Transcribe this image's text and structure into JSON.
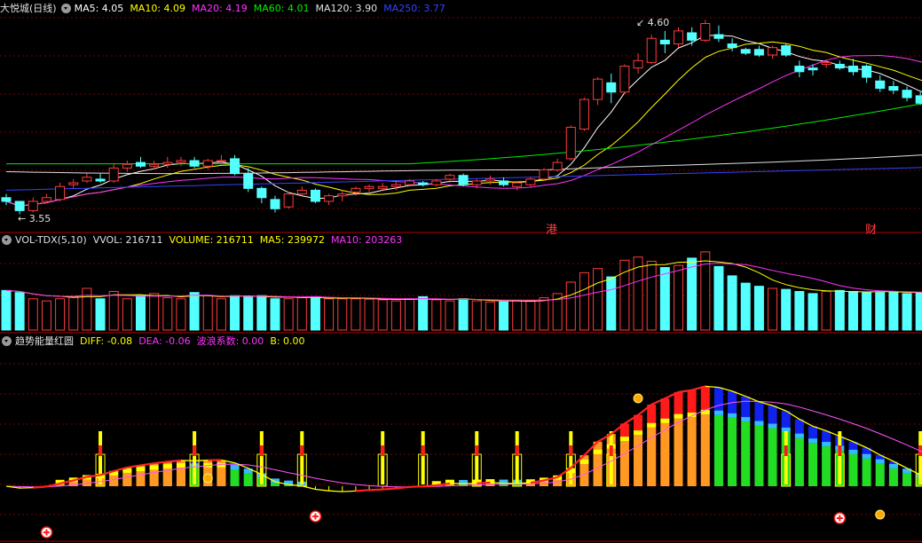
{
  "colors": {
    "up": "#ff3c3c",
    "down": "#54ffff",
    "ma5": "#ffffff",
    "ma10": "#ffff00",
    "ma20": "#ff33ff",
    "ma60": "#00ee00",
    "ma120": "#e0e0e0",
    "ma250": "#3344ff",
    "grid": "#7a0000",
    "separator": "#8c0000",
    "diff": "#ff2222",
    "dea": "#ff55ff",
    "yellow": "#ffff00",
    "orange": "#ff9922",
    "green": "#22dd22",
    "red": "#ff1a1a",
    "blue": "#1122ee",
    "cyan": "#33bbff"
  },
  "price_panel": {
    "title": "大悦城(日线)",
    "ma_labels": [
      {
        "text": "MA5: 4.05",
        "color": "#ffffff"
      },
      {
        "text": "MA10: 4.09",
        "color": "#ffff00"
      },
      {
        "text": "MA20: 4.19",
        "color": "#ff33ff"
      },
      {
        "text": "MA60: 4.01",
        "color": "#00ee00"
      },
      {
        "text": "MA120: 3.90",
        "color": "#e0e0e0"
      },
      {
        "text": "MA250: 3.77",
        "color": "#3344ff"
      }
    ],
    "high_label": "4.60",
    "low_label": "3.55",
    "event_marks": [
      "港",
      "财"
    ]
  },
  "volume_panel": {
    "labels": [
      {
        "text": "VOL-TDX(5,10)",
        "color": "#e0e0e0"
      },
      {
        "text": "VVOL: 216711",
        "color": "#e0e0e0"
      },
      {
        "text": "VOLUME: 216711",
        "color": "#ffff00"
      },
      {
        "text": "MA5: 239972",
        "color": "#ffff00"
      },
      {
        "text": "MA10: 203263",
        "color": "#ff33ff"
      }
    ]
  },
  "indicator_panel": {
    "labels": [
      {
        "text": "趋势能量红圆",
        "color": "#e0e0e0"
      },
      {
        "text": "DIFF: -0.08",
        "color": "#ffff00"
      },
      {
        "text": "DEA: -0.06",
        "color": "#ff33ff"
      },
      {
        "text": "波浪系数: 0.00",
        "color": "#ff33ff"
      },
      {
        "text": "B: 0.00",
        "color": "#ffff00"
      }
    ]
  },
  "chart_data": {
    "type": "candlestick",
    "candles": [
      [
        3.64,
        3.66,
        3.6,
        3.62
      ],
      [
        3.62,
        3.62,
        3.55,
        3.57
      ],
      [
        3.57,
        3.64,
        3.56,
        3.62
      ],
      [
        3.62,
        3.66,
        3.61,
        3.64
      ],
      [
        3.63,
        3.72,
        3.62,
        3.7
      ],
      [
        3.71,
        3.74,
        3.69,
        3.72
      ],
      [
        3.73,
        3.77,
        3.72,
        3.75
      ],
      [
        3.74,
        3.77,
        3.72,
        3.73
      ],
      [
        3.73,
        3.82,
        3.72,
        3.8
      ],
      [
        3.8,
        3.84,
        3.78,
        3.82
      ],
      [
        3.83,
        3.86,
        3.8,
        3.81
      ],
      [
        3.81,
        3.84,
        3.79,
        3.82
      ],
      [
        3.82,
        3.86,
        3.8,
        3.83
      ],
      [
        3.83,
        3.86,
        3.81,
        3.84
      ],
      [
        3.84,
        3.86,
        3.8,
        3.81
      ],
      [
        3.81,
        3.85,
        3.79,
        3.84
      ],
      [
        3.84,
        3.87,
        3.82,
        3.84
      ],
      [
        3.85,
        3.87,
        3.76,
        3.77
      ],
      [
        3.77,
        3.8,
        3.67,
        3.69
      ],
      [
        3.69,
        3.7,
        3.61,
        3.64
      ],
      [
        3.63,
        3.65,
        3.56,
        3.58
      ],
      [
        3.59,
        3.67,
        3.58,
        3.66
      ],
      [
        3.66,
        3.7,
        3.65,
        3.68
      ],
      [
        3.68,
        3.69,
        3.61,
        3.62
      ],
      [
        3.62,
        3.66,
        3.6,
        3.65
      ],
      [
        3.65,
        3.68,
        3.62,
        3.66
      ],
      [
        3.67,
        3.7,
        3.65,
        3.69
      ],
      [
        3.69,
        3.71,
        3.67,
        3.7
      ],
      [
        3.69,
        3.72,
        3.68,
        3.7
      ],
      [
        3.7,
        3.73,
        3.68,
        3.71
      ],
      [
        3.71,
        3.74,
        3.7,
        3.73
      ],
      [
        3.72,
        3.73,
        3.7,
        3.71
      ],
      [
        3.71,
        3.74,
        3.7,
        3.73
      ],
      [
        3.74,
        3.77,
        3.72,
        3.76
      ],
      [
        3.76,
        3.77,
        3.7,
        3.71
      ],
      [
        3.71,
        3.74,
        3.69,
        3.73
      ],
      [
        3.73,
        3.76,
        3.71,
        3.74
      ],
      [
        3.73,
        3.75,
        3.7,
        3.71
      ],
      [
        3.7,
        3.73,
        3.68,
        3.72
      ],
      [
        3.71,
        3.75,
        3.7,
        3.74
      ],
      [
        3.74,
        3.8,
        3.73,
        3.79
      ],
      [
        3.79,
        3.85,
        3.78,
        3.83
      ],
      [
        3.85,
        4.03,
        3.84,
        4.02
      ],
      [
        4.01,
        4.18,
        4.0,
        4.17
      ],
      [
        4.17,
        4.29,
        4.14,
        4.28
      ],
      [
        4.26,
        4.31,
        4.15,
        4.21
      ],
      [
        4.21,
        4.36,
        4.2,
        4.35
      ],
      [
        4.34,
        4.42,
        4.31,
        4.38
      ],
      [
        4.37,
        4.52,
        4.36,
        4.5
      ],
      [
        4.49,
        4.54,
        4.42,
        4.47
      ],
      [
        4.47,
        4.56,
        4.45,
        4.54
      ],
      [
        4.53,
        4.56,
        4.46,
        4.49
      ],
      [
        4.49,
        4.6,
        4.48,
        4.58
      ],
      [
        4.52,
        4.57,
        4.48,
        4.5
      ],
      [
        4.47,
        4.5,
        4.43,
        4.45
      ],
      [
        4.44,
        4.45,
        4.41,
        4.42
      ],
      [
        4.44,
        4.46,
        4.4,
        4.41
      ],
      [
        4.41,
        4.46,
        4.39,
        4.45
      ],
      [
        4.46,
        4.47,
        4.4,
        4.41
      ],
      [
        4.35,
        4.38,
        4.29,
        4.32
      ],
      [
        4.34,
        4.36,
        4.3,
        4.33
      ],
      [
        4.36,
        4.38,
        4.34,
        4.37
      ],
      [
        4.36,
        4.38,
        4.33,
        4.34
      ],
      [
        4.35,
        4.39,
        4.3,
        4.32
      ],
      [
        4.35,
        4.36,
        4.26,
        4.29
      ],
      [
        4.27,
        4.3,
        4.21,
        4.23
      ],
      [
        4.24,
        4.27,
        4.2,
        4.22
      ],
      [
        4.22,
        4.24,
        4.16,
        4.18
      ],
      [
        4.19,
        4.21,
        4.14,
        4.15
      ],
      [
        4.16,
        4.22,
        4.15,
        4.2
      ],
      [
        4.25,
        4.42,
        4.24,
        4.41
      ],
      [
        4.35,
        4.38,
        4.3,
        4.32
      ],
      [
        4.32,
        4.36,
        4.3,
        4.35
      ],
      [
        4.33,
        4.34,
        4.22,
        4.25
      ],
      [
        4.27,
        4.3,
        4.07,
        4.08
      ],
      [
        4.05,
        4.1,
        4.04,
        4.09
      ],
      [
        4.12,
        4.14,
        4.09,
        4.11
      ]
    ],
    "volume": [
      190,
      180,
      150,
      140,
      150,
      160,
      200,
      150,
      185,
      150,
      165,
      175,
      155,
      150,
      180,
      165,
      150,
      165,
      160,
      165,
      150,
      150,
      155,
      160,
      150,
      150,
      150,
      148,
      145,
      140,
      150,
      160,
      145,
      140,
      150,
      140,
      135,
      135,
      140,
      140,
      155,
      175,
      230,
      275,
      295,
      255,
      335,
      350,
      330,
      300,
      310,
      345,
      375,
      305,
      260,
      225,
      210,
      200,
      195,
      185,
      175,
      185,
      190,
      185,
      180,
      180,
      185,
      175,
      180,
      185,
      215,
      235,
      220,
      185,
      205,
      225,
      220
    ],
    "ma_lines": [
      "MA5",
      "MA10",
      "MA20",
      "MA60",
      "MA120",
      "MA250"
    ]
  }
}
